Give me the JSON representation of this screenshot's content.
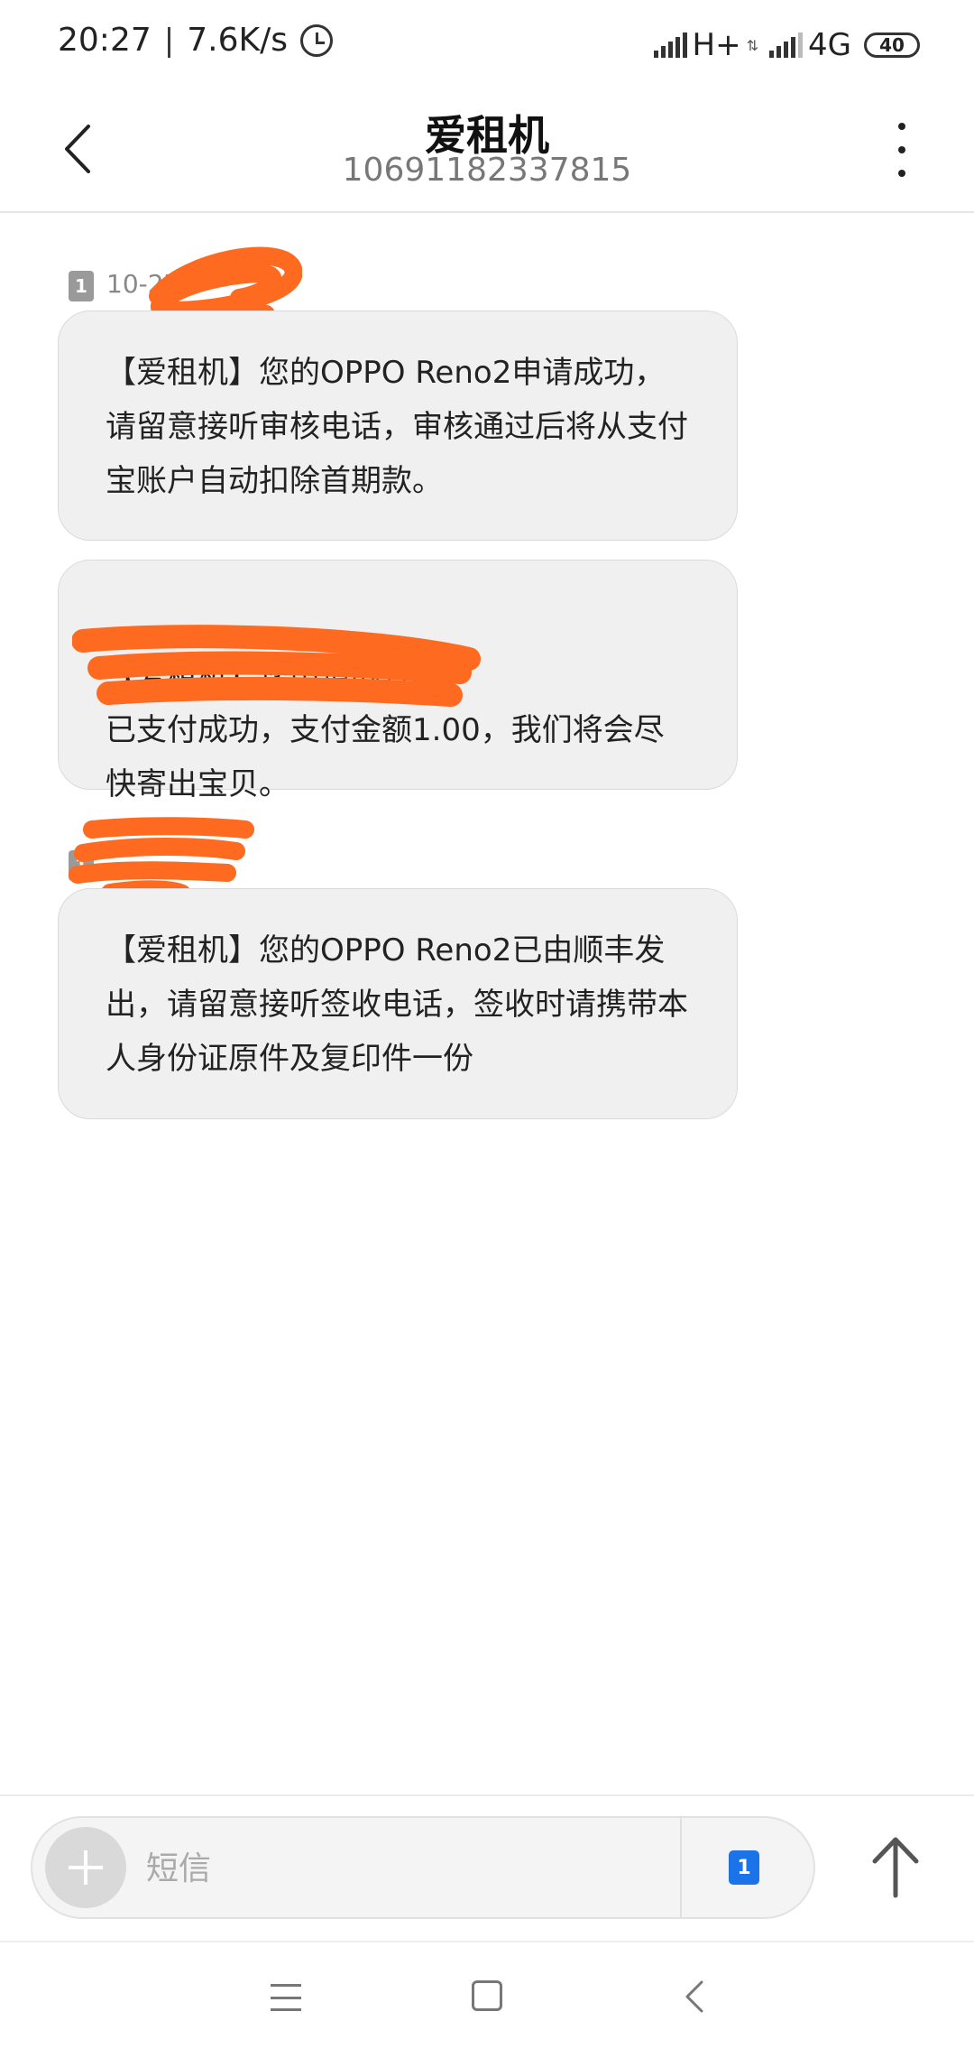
{
  "status_bar": {
    "time": "20:27",
    "separator": "|",
    "speed": "7.6K/s",
    "network1": "H+",
    "network2": "4G",
    "battery": "40"
  },
  "header": {
    "title": "爱租机",
    "number": "10691182337815"
  },
  "messages": [
    {
      "sim": "1",
      "time": "10-27",
      "text": "【爱租机】您的OPPO Reno2申请成功，请留意接听审核电话，审核通过后将从支付宝账户自动扣除首期款。"
    },
    {
      "text": "【爱租机】您申请的订单\n已支付成功，支付金额1.00，我们将会尽快寄出宝贝。"
    },
    {
      "sim": "1",
      "time": "",
      "text": "【爱租机】您的OPPO Reno2已由顺丰发出，请留意接听签收电话，签收时请携带本人身份证原件及复印件一份"
    }
  ],
  "input": {
    "placeholder": "短信",
    "sim_label": "1"
  },
  "colors": {
    "redaction": "#ff6a21",
    "bubble": "#f0f0f0",
    "sim_select": "#1a73e8"
  },
  "icons": {
    "back": "chevron-left-icon",
    "more": "vertical-dots-icon",
    "add": "plus-icon",
    "send": "arrow-up-icon",
    "alarm": "alarm-icon"
  }
}
